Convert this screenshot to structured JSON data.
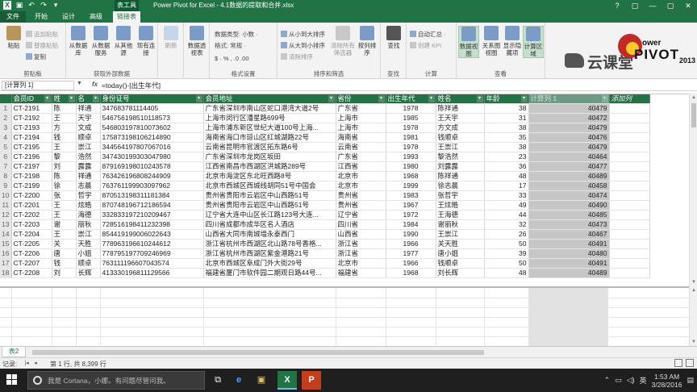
{
  "window": {
    "title": "Power Pivot for Excel - 4.1数据的提取和合并.xlsx",
    "context_tab_title": "表工具",
    "controls": [
      "?",
      "▢",
      "—",
      "▢",
      "✕"
    ]
  },
  "tabs": [
    {
      "label": "文件",
      "type": "file"
    },
    {
      "label": "开始"
    },
    {
      "label": "设计"
    },
    {
      "label": "高级"
    },
    {
      "label": "链接表",
      "active": true
    }
  ],
  "ribbon": {
    "clipboard": {
      "label": "剪贴板",
      "paste": "粘贴",
      "paste_append": "追加粘贴",
      "paste_replace": "替换粘贴",
      "copy": "复制"
    },
    "external": {
      "label": "获取外部数据",
      "from_db": "从数据库",
      "from_service": "从数据服务",
      "from_other": "从其他源",
      "existing": "现有连接"
    },
    "refresh": {
      "label": "刷新"
    },
    "pivot": {
      "label": "数据透视表"
    },
    "format": {
      "label": "格式设置",
      "data_type": "数据类型: 小数 ·",
      "format": "格式: 常规 ·",
      "symbols": "$ · % ,  .0  .00"
    },
    "sort": {
      "label": "排序和筛选",
      "asc": "从小到大排序",
      "desc": "从大到小排序",
      "clear": "清除排序",
      "clear_filters": "清除所有筛选器",
      "by_column": "按列排序"
    },
    "find": {
      "label": "查找",
      "btn": "查找"
    },
    "calc": {
      "label": "计算",
      "autosum": "自动汇总 ·",
      "kpi": "创建 KPI"
    },
    "view": {
      "label": "查看",
      "data_view": "数据视图",
      "diagram_view": "关系图视图",
      "show_hidden": "显示隐藏项",
      "calc_area": "计算区域"
    }
  },
  "brand": {
    "cloud_text": "云课堂",
    "logo_small": "ower",
    "logo_big": "PIVOT",
    "logo_suffix": "2013"
  },
  "formula_bar": {
    "namebox": "[计算列 1]",
    "fx": "fx",
    "formula": "=today()-[出生年代]"
  },
  "table": {
    "columns": [
      "会员ID",
      "姓",
      "名",
      "身份证号",
      "会员地址",
      "省份",
      "出生年代",
      "姓名",
      "年龄",
      "计算列 1",
      "添加列"
    ],
    "rows": [
      [
        "CT-2191",
        "陈",
        "祥通",
        "347683781114405",
        "广东省深圳市南山区蛇口港湾大道2号",
        "广东省",
        "1978",
        "陈祥通",
        "38",
        "40479"
      ],
      [
        "CT-2192",
        "王",
        "天宇",
        "546756198510118573",
        "上海市闵行区漕星路699号",
        "上海市",
        "1985",
        "王天宇",
        "31",
        "40472"
      ],
      [
        "CT-2193",
        "方",
        "文成",
        "546803197810073602",
        "上海市浦东新区世纪大道100号上海...",
        "上海市",
        "1978",
        "方文成",
        "38",
        "40479"
      ],
      [
        "CT-2194",
        "钱",
        "顺卓",
        "175873198106214890",
        "海南省海口市琼山区红城湖路22号",
        "海南省",
        "1981",
        "钱顺卓",
        "35",
        "40476"
      ],
      [
        "CT-2195",
        "王",
        "崇江",
        "344564197807067016",
        "云南省昆明市官渡区拓东路6号",
        "云南省",
        "1978",
        "王崇江",
        "38",
        "40479"
      ],
      [
        "CT-2196",
        "黎",
        "浩然",
        "347430199303047980",
        "广东省深圳市龙岗区坂田",
        "广东省",
        "1993",
        "黎浩然",
        "23",
        "40464"
      ],
      [
        "CT-2197",
        "刘",
        "露露",
        "879169198010243578",
        "江西省南昌市西湖区洪城路289号",
        "江西省",
        "1980",
        "刘露露",
        "36",
        "40477"
      ],
      [
        "CT-2198",
        "陈",
        "祥通",
        "763426196808244909",
        "北京市海淀区东北旺西路8号",
        "北京市",
        "1968",
        "陈祥通",
        "48",
        "40489"
      ],
      [
        "CT-2199",
        "徐",
        "志晨",
        "763761199903097962",
        "北京市西城区西城线胡同51号中国会",
        "北京市",
        "1999",
        "徐志晨",
        "17",
        "40458"
      ],
      [
        "CT-2200",
        "张",
        "哲宇",
        "870513198311181384",
        "贵州省贵阳市云岩区中山西路51号",
        "贵州省",
        "1983",
        "张哲宇",
        "33",
        "40474"
      ],
      [
        "CT-2201",
        "王",
        "炫皓",
        "870748196712186594",
        "贵州省贵阳市云岩区中山西路51号",
        "贵州省",
        "1967",
        "王炫皓",
        "49",
        "40490"
      ],
      [
        "CT-2202",
        "王",
        "海德",
        "332833197210209467",
        "辽宁省大连中山区长江路123号大连...",
        "辽宁省",
        "1972",
        "王海德",
        "44",
        "40485"
      ],
      [
        "CT-2203",
        "谢",
        "丽秋",
        "728516198411232398",
        "四川省成都市成华区名人酒店",
        "四川省",
        "1984",
        "谢丽秋",
        "32",
        "40473"
      ],
      [
        "CT-2204",
        "王",
        "崇江",
        "854419199006022643",
        "山西省大同市南城墙永泰西门",
        "山西省",
        "1990",
        "王崇江",
        "26",
        "40467"
      ],
      [
        "CT-2205",
        "关",
        "天胜",
        "778963196610244612",
        "浙江省杭州市西湖区北山路78号香格...",
        "浙江省",
        "1966",
        "关天胜",
        "50",
        "40491"
      ],
      [
        "CT-2206",
        "唐",
        "小姐",
        "778795197709246969",
        "浙江省杭州市西湖区紫金港路21号",
        "浙江省",
        "1977",
        "唐小姐",
        "39",
        "40480"
      ],
      [
        "CT-2207",
        "钱",
        "顺卓",
        "763111196607043574",
        "北京市西城区阜成门外大街29号",
        "北京市",
        "1966",
        "钱顺卓",
        "50",
        "40491"
      ],
      [
        "CT-2208",
        "刘",
        "长辉",
        "413330196811129566",
        "福建省厦门市软件园二期观日路44号...",
        "福建省",
        "1968",
        "刘长辉",
        "48",
        "40489"
      ]
    ]
  },
  "sheet_tab": "表2",
  "status": {
    "label": "记录:",
    "record": "第 1 行, 共 8,399 行"
  },
  "taskbar": {
    "search_placeholder": "我是 Cortana，小娜。有问题尽管问我。",
    "time": "1:53 AM",
    "date": "3/28/2016",
    "apps": [
      "⧉",
      "e",
      "▣",
      "X",
      "P"
    ]
  }
}
